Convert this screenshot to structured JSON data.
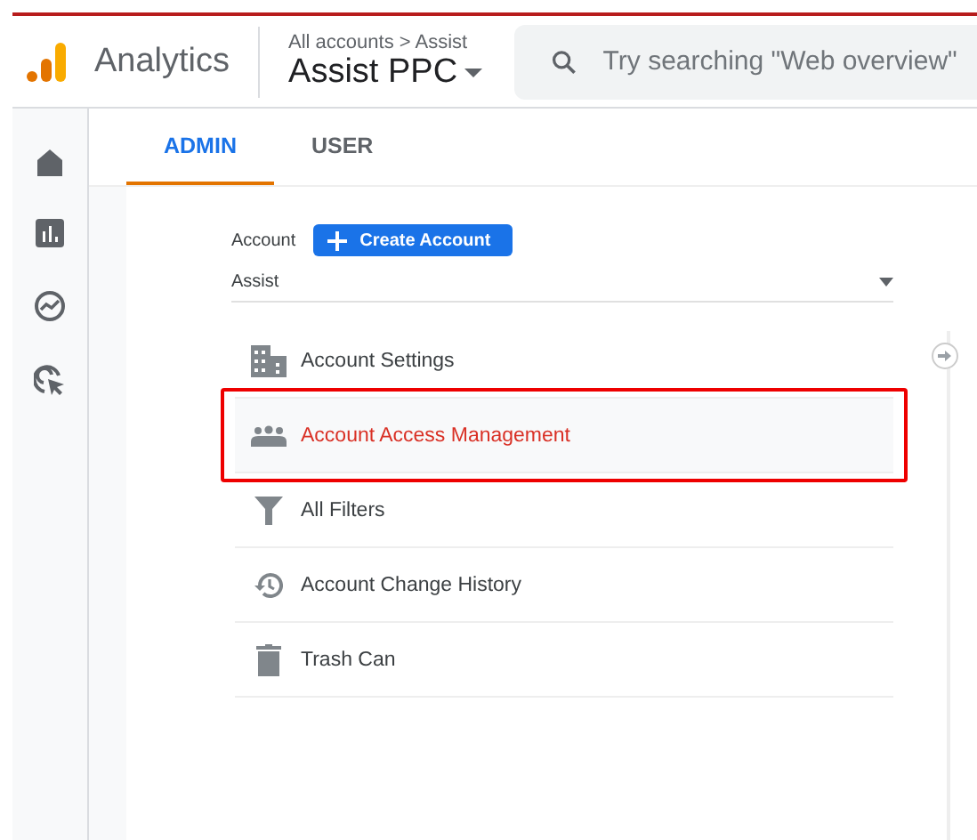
{
  "header": {
    "app_name": "Analytics",
    "breadcrumb": "All accounts > Assist",
    "property": "Assist PPC",
    "search": {
      "placeholder": "Try searching \"Web overview\""
    }
  },
  "tabs": [
    {
      "label": "ADMIN",
      "selected": true
    },
    {
      "label": "USER",
      "selected": false
    }
  ],
  "account": {
    "label": "Account",
    "create_button": "Create Account",
    "selected_account": "Assist"
  },
  "items": [
    {
      "label": "Account Settings",
      "selected": false,
      "highlighted": false
    },
    {
      "label": "Account Access Management",
      "selected": true,
      "highlighted": true
    },
    {
      "label": "All Filters",
      "selected": false,
      "highlighted": false
    },
    {
      "label": "Account Change History",
      "selected": false,
      "highlighted": false
    },
    {
      "label": "Trash Can",
      "selected": false,
      "highlighted": false
    }
  ]
}
